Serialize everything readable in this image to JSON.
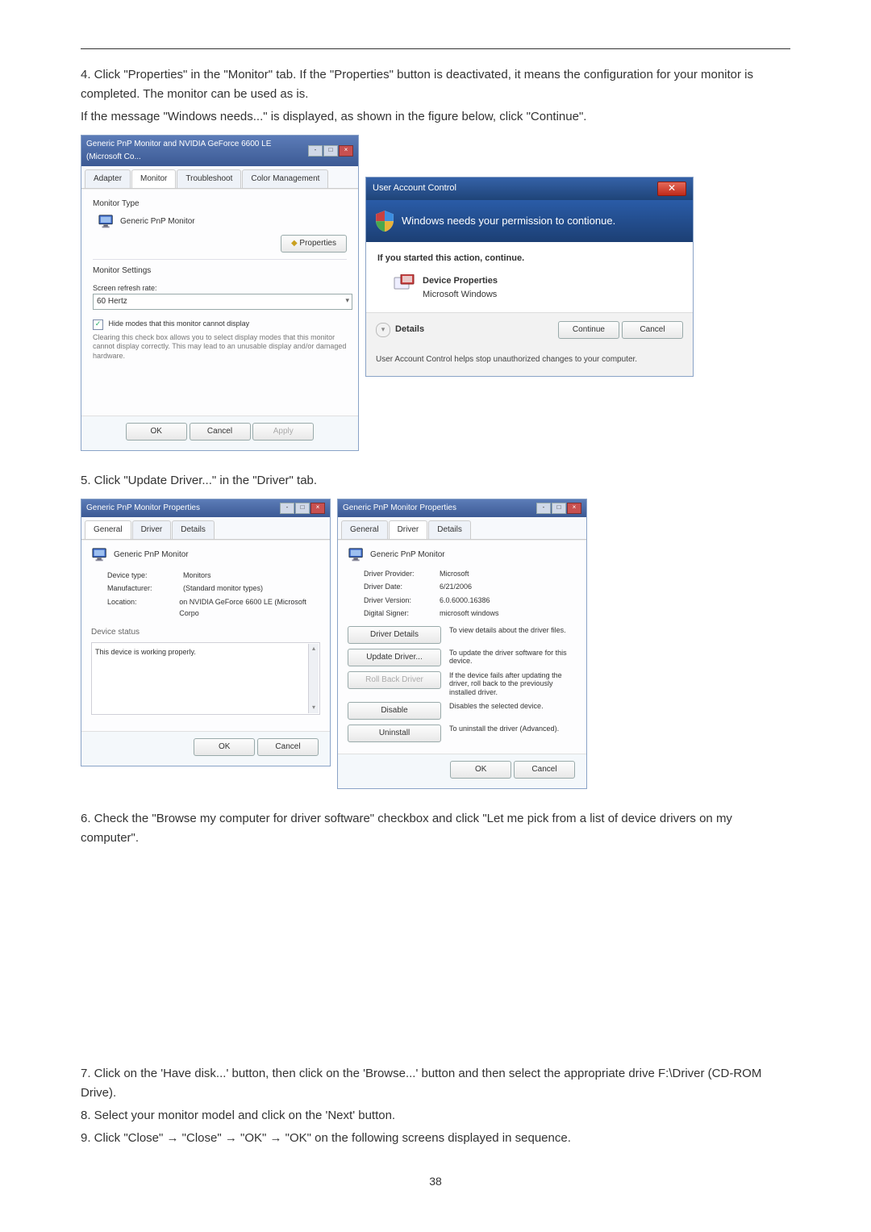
{
  "step4": "4. Click \"Properties\" in the \"Monitor\" tab. If the \"Properties\" button is deactivated, it means the configuration for your monitor is completed. The monitor can be used as is.",
  "step4b": "If the message \"Windows needs...\" is displayed, as shown in the figure below, click \"Continue\".",
  "step5": "5. Click \"Update Driver...\" in the \"Driver\" tab.",
  "step6": "6. Check the \"Browse my computer for driver software\" checkbox and click \"Let me pick from a list of device drivers on my computer\".",
  "step7": "7. Click on the 'Have disk...' button, then click on the 'Browse...' button and then select the appropriate drive F:\\Driver (CD-ROM Drive).",
  "step8": "8. Select your monitor model and click on the 'Next' button.",
  "step9": "9. Click \"Close\"  →  \"Close\"  →  \"OK\"  →  \"OK\" on the following screens displayed in sequence.",
  "pagenum": "38",
  "monprops": {
    "title": "Generic PnP Monitor and NVIDIA GeForce 6600 LE (Microsoft Co...",
    "tabs": [
      "Adapter",
      "Monitor",
      "Troubleshoot",
      "Color Management"
    ],
    "section1": "Monitor Type",
    "montype": "Generic PnP Monitor",
    "props_btn": "Properties",
    "section2": "Monitor Settings",
    "refresh_lbl": "Screen refresh rate:",
    "refresh_val": "60 Hertz",
    "hide_chk": "Hide modes that this monitor cannot display",
    "hide_desc": "Clearing this check box allows you to select display modes that this monitor cannot display correctly. This may lead to an unusable display and/or damaged hardware.",
    "ok": "OK",
    "cancel": "Cancel",
    "apply": "Apply"
  },
  "uac": {
    "title": "User Account Control",
    "banner": "Windows needs your permission to contionue.",
    "started": "If you started this action, continue.",
    "progname": "Device Properties",
    "progpub": "Microsoft Windows",
    "details": "Details",
    "continue": "Continue",
    "cancel": "Cancel",
    "foot": "User Account Control helps stop unauthorized changes to your computer."
  },
  "general": {
    "wintitle": "Generic PnP Monitor Properties",
    "tabs": [
      "General",
      "Driver",
      "Details"
    ],
    "name": "Generic PnP Monitor",
    "devtype_k": "Device type:",
    "devtype_v": "Monitors",
    "manu_k": "Manufacturer:",
    "manu_v": "(Standard monitor types)",
    "loc_k": "Location:",
    "loc_v": "on NVIDIA GeForce 6600 LE (Microsoft Corpo",
    "status_lbl": "Device status",
    "status_txt": "This device is working properly.",
    "ok": "OK",
    "cancel": "Cancel"
  },
  "driver": {
    "wintitle": "Generic PnP Monitor Properties",
    "tabs": [
      "General",
      "Driver",
      "Details"
    ],
    "name": "Generic PnP Monitor",
    "prov_k": "Driver Provider:",
    "prov_v": "Microsoft",
    "date_k": "Driver Date:",
    "date_v": "6/21/2006",
    "ver_k": "Driver Version:",
    "ver_v": "6.0.6000.16386",
    "sig_k": "Digital Signer:",
    "sig_v": "microsoft windows",
    "details_btn": "Driver Details",
    "details_desc": "To view details about the driver files.",
    "update_btn": "Update Driver...",
    "update_desc": "To update the driver software for this device.",
    "roll_btn": "Roll Back Driver",
    "roll_desc": "If the device fails after updating the driver, roll back to the previously installed driver.",
    "disable_btn": "Disable",
    "disable_desc": "Disables the selected device.",
    "uninst_btn": "Uninstall",
    "uninst_desc": "To uninstall the driver (Advanced).",
    "ok": "OK",
    "cancel": "Cancel"
  }
}
